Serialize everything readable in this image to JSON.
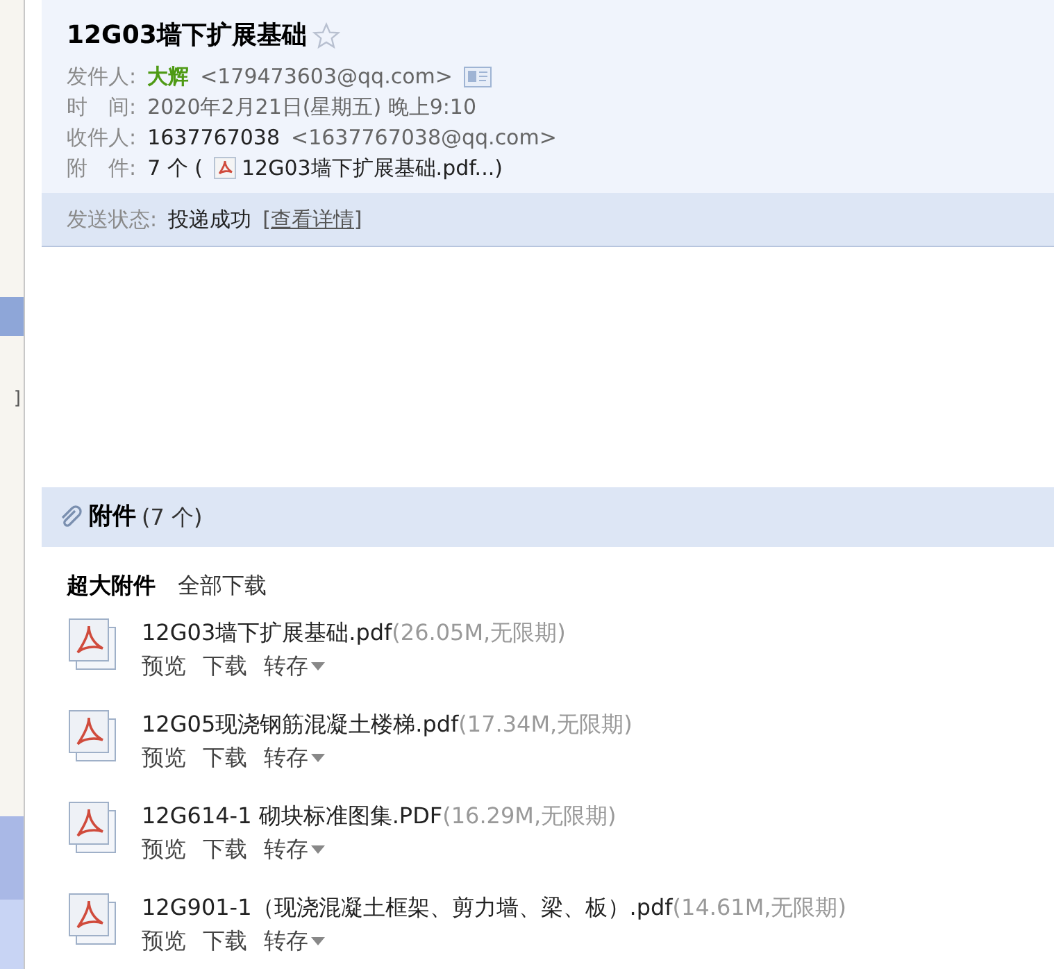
{
  "sidebar": {
    "fragment": "]"
  },
  "mail": {
    "subject": "12G03墙下扩展基础",
    "starred": false,
    "fields": [
      {
        "kind": "sender",
        "label": "发件人:",
        "name": "大辉",
        "value": "<179473603@qq.com>"
      },
      {
        "kind": "plain",
        "label": "时　间:",
        "value": "2020年2月21日(星期五) 晚上9:10"
      },
      {
        "kind": "recipient",
        "label": "收件人:",
        "name": "1637767038",
        "value": "<1637767038@qq.com>"
      },
      {
        "kind": "attachment",
        "label": "附　件:",
        "count": "7 个 (",
        "value": "12G03墙下扩展基础.pdf...)"
      }
    ],
    "status": {
      "label": "发送状态:",
      "value": "投递成功",
      "link": "[查看详情]"
    }
  },
  "attachments": {
    "title": "附件",
    "count": "(7 个)",
    "section": "超大附件",
    "download_all": "全部下载",
    "files": [
      {
        "name": "12G03墙下扩展基础.pdf",
        "meta": "(26.05M,无限期)",
        "actions": [
          "预览",
          "下载",
          "转存"
        ]
      },
      {
        "name": "12G05现浇钢筋混凝土楼梯.pdf",
        "meta": "(17.34M,无限期)",
        "actions": [
          "预览",
          "下载",
          "转存"
        ]
      },
      {
        "name": "12G614-1 砌块标准图集.PDF",
        "meta": "(16.29M,无限期)",
        "actions": [
          "预览",
          "下载",
          "转存"
        ]
      },
      {
        "name": "12G901-1（现浇混凝土框架、剪力墙、梁、板）.pdf",
        "meta": "(14.61M,无限期)",
        "actions": [
          "预览",
          "下载",
          "转存"
        ]
      }
    ]
  }
}
